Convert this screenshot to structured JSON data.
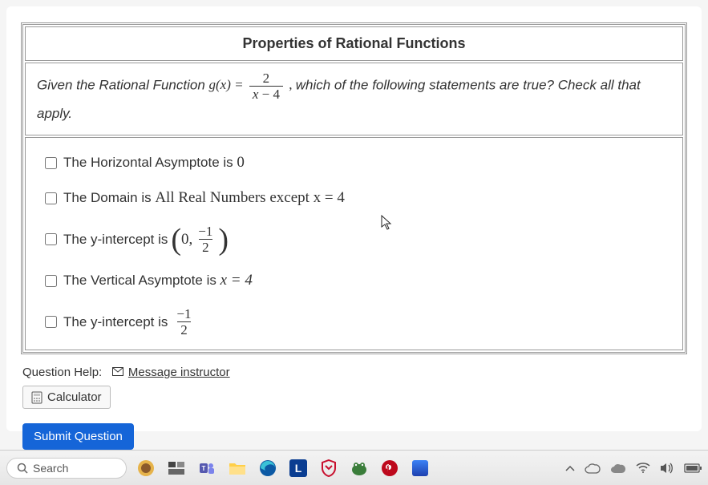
{
  "table": {
    "header": "Properties of Rational Functions",
    "prompt_pre": "Given the Rational Function ",
    "prompt_fn": "g(x) = ",
    "prompt_frac_num": "2",
    "prompt_frac_den_left": "x",
    "prompt_frac_den_op": " − ",
    "prompt_frac_den_right": "4",
    "prompt_post_comma": ",",
    "prompt_post": " which of the following statements are true? Check all that apply."
  },
  "options": {
    "o1_text": "The Horizontal Asymptote is ",
    "o1_val": "0",
    "o2_pre": "The Domain is ",
    "o2_mid": "All Real Numbers except x = 4",
    "o3_text": "The y-intercept is ",
    "o3_point_x": "0",
    "o3_point_comma": ", ",
    "o3_frac_num": "−1",
    "o3_frac_den": "2",
    "o4_text": "The Vertical Asymptote is ",
    "o4_val": "x = 4",
    "o5_text": "The y-intercept is ",
    "o5_frac_num": "−1",
    "o5_frac_den": "2"
  },
  "help": {
    "label": "Question Help:",
    "link": "Message instructor",
    "calc": "Calculator"
  },
  "submit": {
    "label": "Submit Question"
  },
  "taskbar": {
    "search_placeholder": "Search"
  }
}
